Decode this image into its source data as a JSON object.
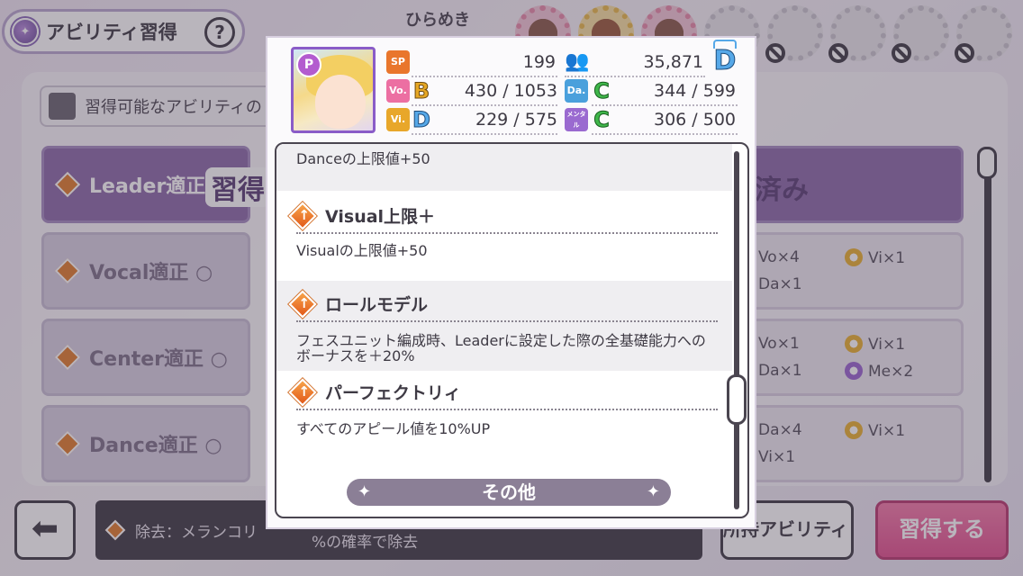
{
  "header": {
    "title": "アビリティ習得",
    "help_label": "?",
    "hirameki_label": "ひらめき"
  },
  "filter": {
    "checkbox_label": "習得可能なアビリティの"
  },
  "ability_list": {
    "rows": [
      {
        "label": "Leader適正"
      },
      {
        "label": "Vocal適正 ○"
      },
      {
        "label": "Center適正 ○"
      },
      {
        "label": "Dance適正 ○"
      }
    ],
    "acquired_tag": "習得",
    "done_tag": "済み"
  },
  "requirements": [
    {
      "line1": "Vo×4",
      "line2": "Da×1",
      "side": "Vi×1",
      "side_color": "yellow"
    },
    {
      "line1": "Vo×1",
      "line2": "Da×1",
      "side1": "Vi×1",
      "side2": "Me×2"
    },
    {
      "line1": "Da×4",
      "line2": "Vi×1",
      "side": "Vi×1",
      "side_color": "yellow"
    }
  ],
  "footer": {
    "back_icon": "arrow-left-icon",
    "info_text": "除去：メランコリ",
    "info_tail": "%の確率で除去",
    "owned_label": "所持アビリティ",
    "acquire_label": "習得する"
  },
  "modal": {
    "card_badge": "P",
    "rank": "D",
    "stats": {
      "sp": {
        "icon_label": "SP",
        "value": "199"
      },
      "fans": {
        "value": "35,871"
      },
      "vo": {
        "icon_label": "Vo.",
        "grade": "B",
        "value": "430 / 1053"
      },
      "da": {
        "icon_label": "Da.",
        "grade": "C",
        "value": "344 / 599"
      },
      "vi": {
        "icon_label": "Vi.",
        "grade": "D",
        "value": "229 / 575"
      },
      "me": {
        "icon_label": "メンタル",
        "grade": "C",
        "value": "306 / 500"
      }
    },
    "entries": [
      {
        "title": "",
        "desc": "Danceの上限値+50"
      },
      {
        "title": "Visual上限＋",
        "desc": "Visualの上限値+50"
      },
      {
        "title": "ロールモデル",
        "desc": "フェスユニット編成時、Leaderに設定した際の全基礎能力への ボーナスを＋20%"
      },
      {
        "title": "パーフェクトリィ",
        "desc": "すべてのアピール値を10%UP"
      }
    ],
    "section_label": "その他"
  },
  "colors": {
    "accent_orange": "#e07c2c",
    "accent_pink": "#e2508e",
    "panel_purple": "#8b6aa8"
  }
}
